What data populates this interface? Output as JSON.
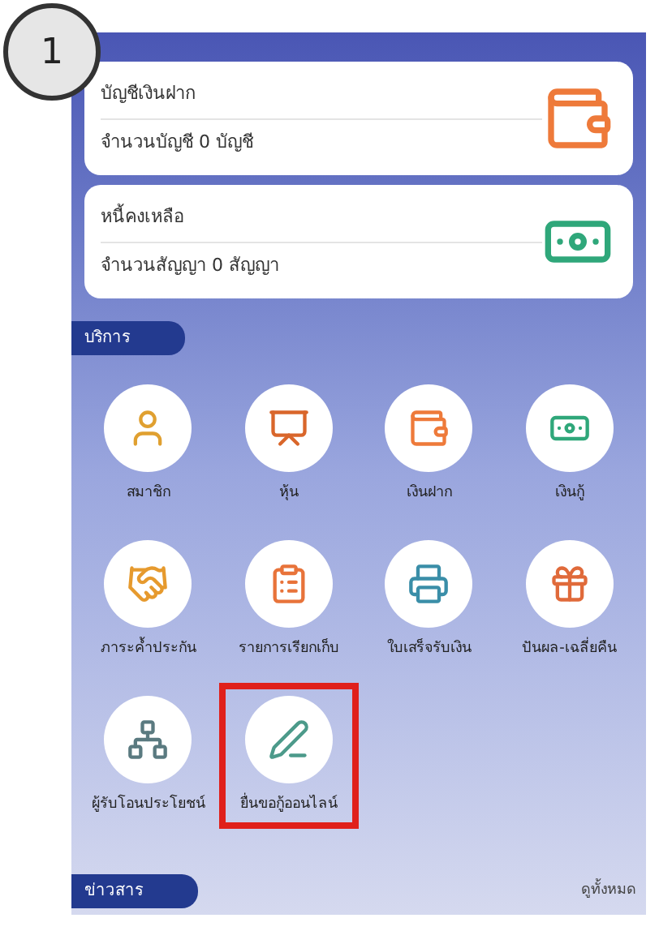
{
  "step_badge": "1",
  "summary_cards": [
    {
      "title": "บัญชีเงินฝาก",
      "detail": "จำนวนบัญชี 0 บัญชี",
      "kind": "wallet"
    },
    {
      "title": "หนี้คงเหลือ",
      "detail": "จำนวนสัญญา 0 สัญญา",
      "kind": "money"
    }
  ],
  "services": {
    "heading": "บริการ",
    "items": [
      {
        "label": "สมาชิก",
        "kind": "member",
        "highlighted": false
      },
      {
        "label": "หุ้น",
        "kind": "chart",
        "highlighted": false
      },
      {
        "label": "เงินฝาก",
        "kind": "wallet",
        "highlighted": false
      },
      {
        "label": "เงินกู้",
        "kind": "money",
        "highlighted": false
      },
      {
        "label": "ภาระค้ำประกัน",
        "kind": "handshake",
        "highlighted": false
      },
      {
        "label": "รายการเรียกเก็บ",
        "kind": "list",
        "highlighted": false
      },
      {
        "label": "ใบเสร็จรับเงิน",
        "kind": "printer",
        "highlighted": false
      },
      {
        "label": "ปันผล-เฉลี่ยคืน",
        "kind": "gift",
        "highlighted": false
      },
      {
        "label": "ผู้รับโอนประโยชน์",
        "kind": "network",
        "highlighted": false
      },
      {
        "label": "ยื่นขอกู้ออนไลน์",
        "kind": "apply",
        "highlighted": true
      }
    ]
  },
  "news": {
    "heading": "ข่าวสาร",
    "link": "ดูทั้งหมด"
  }
}
